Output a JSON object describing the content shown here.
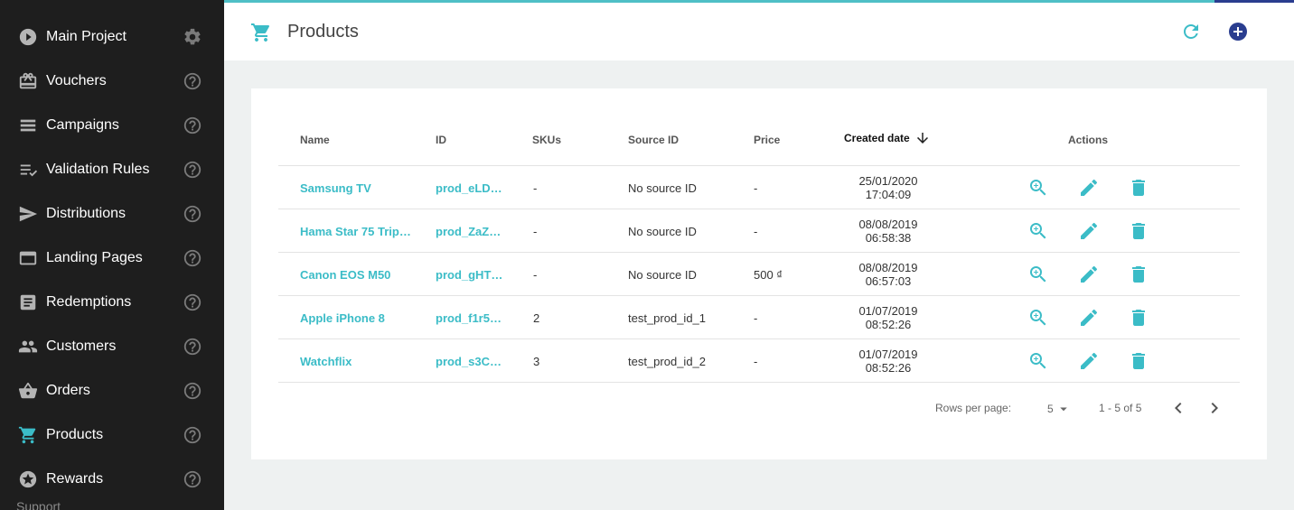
{
  "sidebar": {
    "project": {
      "label": "Main Project",
      "icon": "play-circle-icon",
      "aux_icon": "gear-icon"
    },
    "items": [
      {
        "label": "Vouchers",
        "icon": "voucher-icon"
      },
      {
        "label": "Campaigns",
        "icon": "list-icon"
      },
      {
        "label": "Validation Rules",
        "icon": "checklist-icon"
      },
      {
        "label": "Distributions",
        "icon": "send-icon"
      },
      {
        "label": "Landing Pages",
        "icon": "web-icon"
      },
      {
        "label": "Redemptions",
        "icon": "receipt-icon"
      },
      {
        "label": "Customers",
        "icon": "people-icon"
      },
      {
        "label": "Orders",
        "icon": "basket-icon"
      },
      {
        "label": "Products",
        "icon": "cart-icon",
        "active": true
      },
      {
        "label": "Rewards",
        "icon": "star-icon"
      }
    ],
    "support_label": "Support"
  },
  "header": {
    "title": "Products",
    "icon": "cart-icon",
    "accent_color": "#3bbcc7",
    "add_color": "#2a3d8f"
  },
  "table": {
    "columns": {
      "name": "Name",
      "id": "ID",
      "skus": "SKUs",
      "source_id": "Source ID",
      "price": "Price",
      "created_date": "Created date",
      "actions": "Actions"
    },
    "rows": [
      {
        "name": "Samsung TV",
        "id": "prod_eLD…",
        "skus": "-",
        "source_id": "No source ID",
        "price": "-",
        "date": "25/01/2020",
        "time": "17:04:09"
      },
      {
        "name": "Hama Star 75 Trip…",
        "id": "prod_ZaZ…",
        "skus": "-",
        "source_id": "No source ID",
        "price": "-",
        "date": "08/08/2019",
        "time": "06:58:38"
      },
      {
        "name": "Canon EOS M50",
        "id": "prod_gHT…",
        "skus": "-",
        "source_id": "No source ID",
        "price": "500 ₫",
        "date": "08/08/2019",
        "time": "06:57:03"
      },
      {
        "name": "Apple iPhone 8",
        "id": "prod_f1r5…",
        "skus": "2",
        "source_id": "test_prod_id_1",
        "price": "-",
        "date": "01/07/2019",
        "time": "08:52:26"
      },
      {
        "name": "Watchflix",
        "id": "prod_s3C…",
        "skus": "3",
        "source_id": "test_prod_id_2",
        "price": "-",
        "date": "01/07/2019",
        "time": "08:52:26"
      }
    ]
  },
  "pagination": {
    "rows_per_page_label": "Rows per page:",
    "rows_per_page": "5",
    "range": "1 - 5 of 5"
  }
}
